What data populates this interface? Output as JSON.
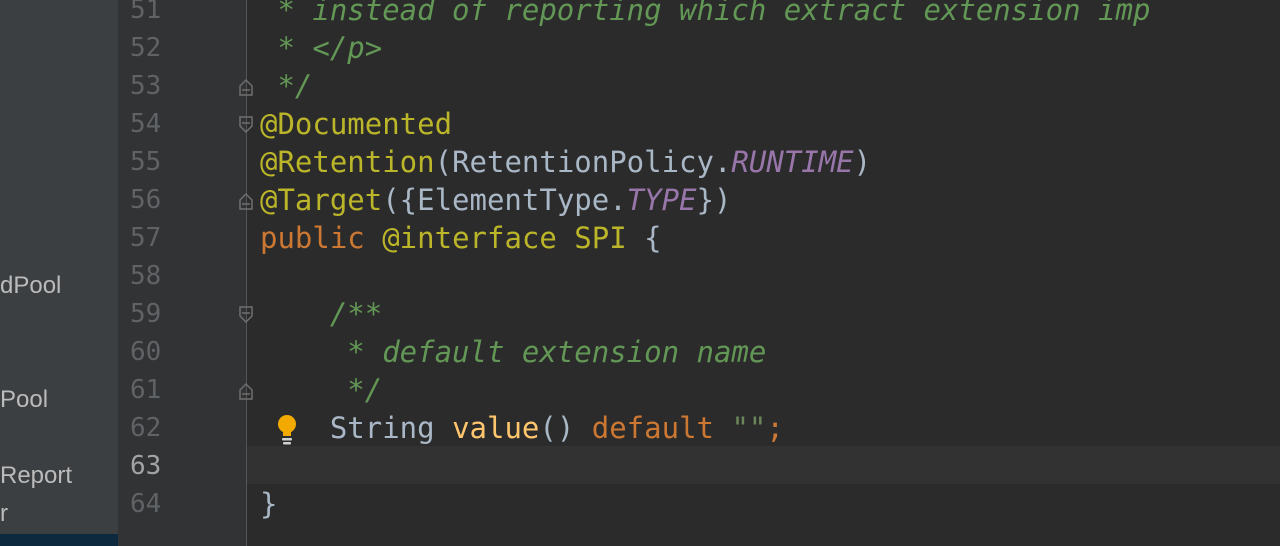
{
  "sidebar": {
    "items": [
      "dPool",
      "Pool",
      " Report",
      "r"
    ]
  },
  "editor": {
    "current_line": "63",
    "lines": [
      {
        "num": "51",
        "text": " * instead of reporting which extract extension imp"
      },
      {
        "num": "52",
        "text": " * </p>"
      },
      {
        "num": "53",
        "text": " */"
      },
      {
        "num": "54",
        "text": "@Documented"
      },
      {
        "num": "55",
        "ann": "@Retention",
        "p1": "(RetentionPolicy.",
        "cst": "RUNTIME",
        "p2": ")"
      },
      {
        "num": "56",
        "ann": "@Target",
        "p1": "({ElementType.",
        "cst": "TYPE",
        "p2": "})"
      },
      {
        "num": "57",
        "kw": "public",
        "ann": " @interface",
        "name": " SPI",
        "p": " {"
      },
      {
        "num": "58"
      },
      {
        "num": "59",
        "text": "    /**"
      },
      {
        "num": "60",
        "text": "     * default extension name"
      },
      {
        "num": "61",
        "text": "     */"
      },
      {
        "num": "62",
        "type": "    String ",
        "fn": "value",
        "p1": "() ",
        "kw": "default",
        "str": " \"\"",
        "semi": ";"
      },
      {
        "num": "63"
      },
      {
        "num": "64",
        "text": "}"
      }
    ]
  },
  "colors": {
    "comment": "#629755",
    "annotation": "#bbb529",
    "keyword": "#cc7832",
    "constant": "#9876aa",
    "method": "#ffc66d",
    "text": "#a9b7c6",
    "background": "#2b2b2b"
  },
  "icons": [
    "lightbulb-icon",
    "fold-marker-icon"
  ]
}
